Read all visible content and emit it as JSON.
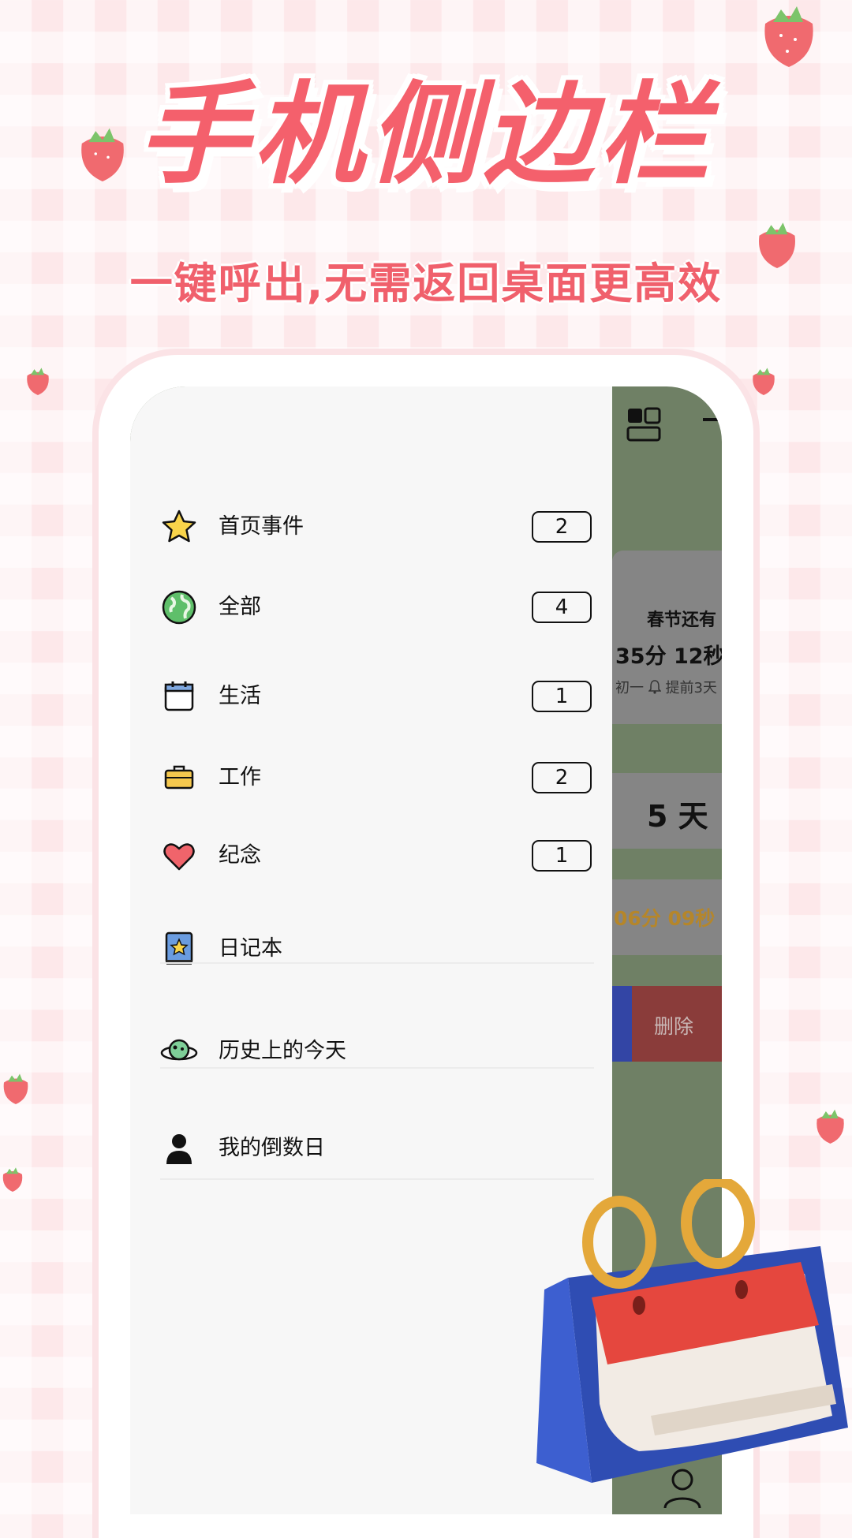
{
  "promo": {
    "headline": "手机侧边栏",
    "subline": "一键呼出,无需返回桌面更高效"
  },
  "drawer": {
    "categories": [
      {
        "label": "首页事件",
        "count": "2",
        "icon": "star-icon"
      },
      {
        "label": "全部",
        "count": "4",
        "icon": "globe-icon"
      },
      {
        "label": "生活",
        "count": "1",
        "icon": "calendar-icon"
      },
      {
        "label": "工作",
        "count": "2",
        "icon": "briefcase-icon"
      },
      {
        "label": "纪念",
        "count": "1",
        "icon": "heart-icon"
      }
    ],
    "links": [
      {
        "label": "日记本",
        "icon": "diary-book-icon"
      },
      {
        "label": "历史上的今天",
        "icon": "planet-icon"
      },
      {
        "label": "我的倒数日",
        "icon": "person-icon"
      }
    ]
  },
  "background_screen": {
    "card1_title": "春节还有",
    "card1_timer": "35分 12秒",
    "card1_meta": "初一 ",
    "card1_reminder": "提前3天",
    "card2_days": "5 天",
    "card3_timer": "06分 09秒",
    "delete_label": "删除"
  },
  "colors": {
    "accent_pink": "#f4606c",
    "overlay_green": "#6f8065",
    "delete_red": "#8a3c3a",
    "timer_orange": "#b5862a"
  }
}
